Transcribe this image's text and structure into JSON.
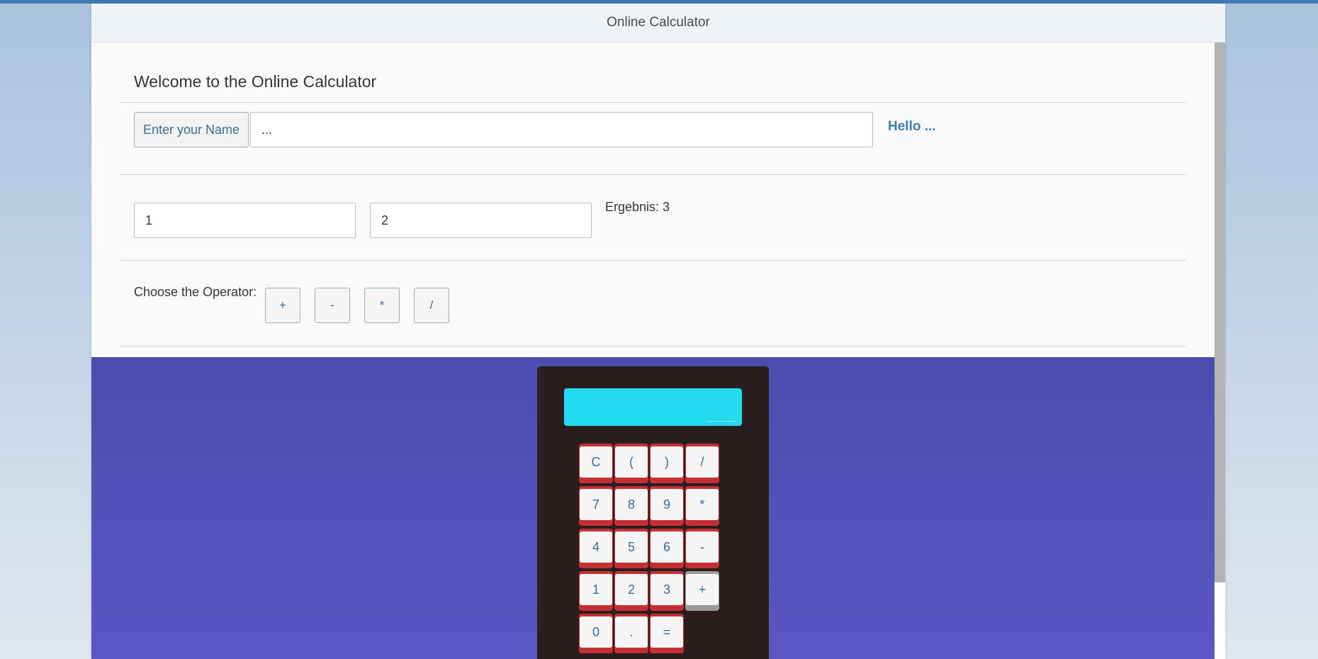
{
  "header": {
    "title": "Online Calculator"
  },
  "welcome": "Welcome to the Online Calculator",
  "name_row": {
    "label_button": "Enter your Name",
    "name_value": "...",
    "greeting": "Hello ..."
  },
  "numbers": {
    "first_value": "1",
    "second_value": "2",
    "result": "Ergebnis: 3"
  },
  "operators": {
    "label": "Choose the Operator:",
    "buttons": [
      "+",
      "-",
      "*",
      "/"
    ]
  },
  "calculator": {
    "display": "",
    "keys": [
      "C",
      "(",
      ")",
      "/",
      "7",
      "8",
      "9",
      "*",
      "4",
      "5",
      "6",
      "-",
      "1",
      "2",
      "3",
      "+",
      "0",
      ".",
      "="
    ]
  }
}
